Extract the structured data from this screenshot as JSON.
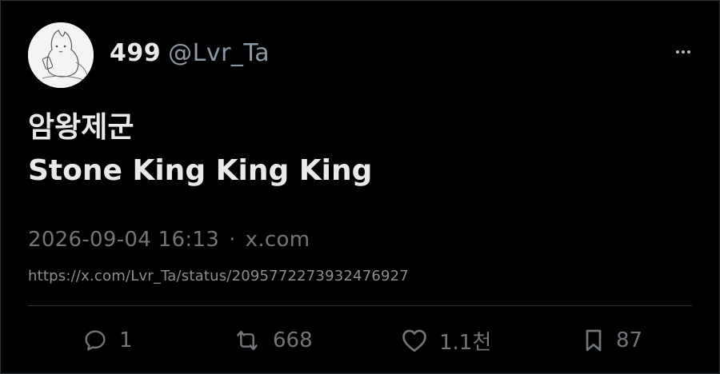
{
  "author": {
    "display_name": "499",
    "handle": "@Lvr_Ta",
    "avatar_icon": "avatar-sketch-icon"
  },
  "post": {
    "line1": "암왕제군",
    "line2": "Stone King King King"
  },
  "meta": {
    "timestamp": "2026-09-04 16:13",
    "separator": "·",
    "source": "x.com"
  },
  "status_url": "https://x.com/Lvr_Ta/status/2095772273932476927",
  "actions": {
    "replies": "1",
    "reposts": "668",
    "likes": "1.1천",
    "bookmarks": "87"
  },
  "colors": {
    "background": "#000000",
    "primary_text": "#e7e9ea",
    "secondary_text": "#71767b",
    "border": "#2f3336"
  }
}
